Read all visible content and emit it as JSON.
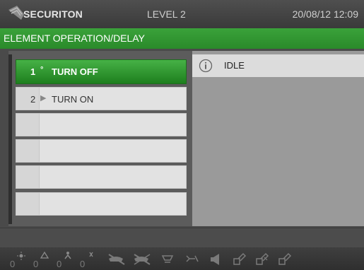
{
  "header": {
    "brand": "SECURITON",
    "level": "LEVEL 2",
    "datetime": "20/08/12 12:09"
  },
  "title": "ELEMENT OPERATION/DELAY",
  "operations": [
    {
      "number": "1",
      "label": "TURN OFF",
      "marker": "°",
      "selected": true
    },
    {
      "number": "2",
      "label": "TURN ON",
      "marker": "▶",
      "selected": false
    },
    {
      "number": "",
      "label": "",
      "marker": "",
      "selected": false
    },
    {
      "number": "",
      "label": "",
      "marker": "",
      "selected": false
    },
    {
      "number": "",
      "label": "",
      "marker": "",
      "selected": false
    },
    {
      "number": "",
      "label": "",
      "marker": "",
      "selected": false
    }
  ],
  "status": {
    "icon": "info-icon",
    "text": "IDLE"
  },
  "toolbar": {
    "counters": [
      "0",
      "0",
      "0",
      "0"
    ],
    "icons": [
      "sun-icon",
      "warning-triangle-icon",
      "person-icon",
      "tool-icon",
      "detector-off-icon",
      "detector-crossed-icon",
      "bell-icon",
      "sprinkler-icon",
      "speaker-icon",
      "key-lock-icon",
      "key-lock-icon",
      "key-lock-icon"
    ]
  },
  "colors": {
    "accent_green": "#2a8a2a",
    "status_panel": "#9a9a9a",
    "background": "#4a4a4a"
  }
}
